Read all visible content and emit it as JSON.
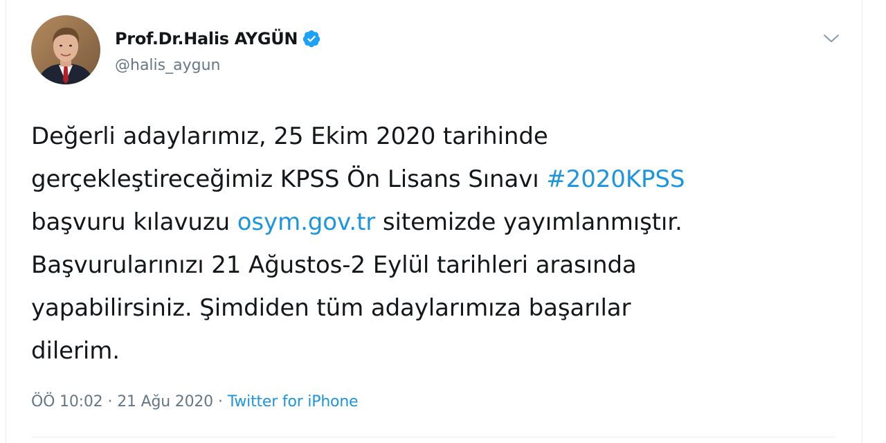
{
  "author": {
    "display_name": "Prof.Dr.Halis AYGÜN",
    "handle": "@halis_aygun",
    "verified": true
  },
  "tweet": {
    "line1": "Değerli adaylarımız, 25 Ekim 2020 tarihinde",
    "line2_text": "gerçekleştireceğimiz KPSS Ön Lisans Sınavı ",
    "line2_hashtag": "#2020KPSS",
    "line3_text_a": "başvuru kılavuzu ",
    "line3_link": "osym.gov.tr",
    "line3_text_b": " sitemizde yayımlanmıştır.",
    "line4": "Başvurularınızı 21 Ağustos-2 Eylül tarihleri arasında",
    "line5": "yapabilirsiniz. Şimdiden tüm adaylarımıza başarılar",
    "line6": "dilerim."
  },
  "meta": {
    "time": "ÖÖ 10:02",
    "separator": "·",
    "date": "21 Ağu 2020",
    "source": "Twitter for iPhone"
  },
  "icons": {
    "verified": "verified-badge-icon",
    "menu": "chevron-down-icon"
  },
  "colors": {
    "link": "#1b95e0",
    "text": "#14171a",
    "secondary": "#657786",
    "verified": "#1da1f2"
  }
}
